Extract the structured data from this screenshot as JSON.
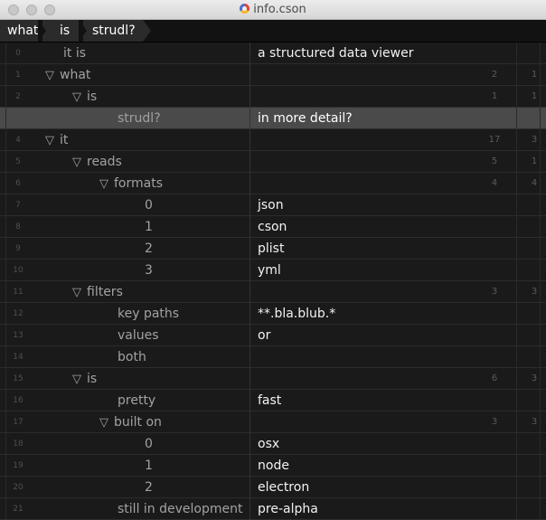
{
  "window": {
    "title": "info.cson",
    "file_icon": "document-color-icon"
  },
  "breadcrumb": [
    "what",
    "is",
    "strudl?"
  ],
  "rows": [
    {
      "num": "0",
      "depth": 0,
      "tri": false,
      "key": "it is",
      "value": "a structured data viewer",
      "c1": "",
      "c2": ""
    },
    {
      "num": "1",
      "depth": 0,
      "tri": true,
      "key": "what",
      "value": "",
      "c1": "2",
      "c2": "1"
    },
    {
      "num": "2",
      "depth": 1,
      "tri": true,
      "key": "is",
      "value": "",
      "c1": "1",
      "c2": "1"
    },
    {
      "num": "",
      "depth": 2,
      "tri": false,
      "key": "strudl?",
      "value": "in more detail?",
      "c1": "",
      "c2": "",
      "selected": true
    },
    {
      "num": "4",
      "depth": 0,
      "tri": true,
      "key": "it",
      "value": "",
      "c1": "17",
      "c2": "3"
    },
    {
      "num": "5",
      "depth": 1,
      "tri": true,
      "key": "reads",
      "value": "",
      "c1": "5",
      "c2": "1"
    },
    {
      "num": "6",
      "depth": 2,
      "tri": true,
      "key": "formats",
      "value": "",
      "c1": "4",
      "c2": "4"
    },
    {
      "num": "7",
      "depth": 3,
      "tri": false,
      "key": "0",
      "value": "json",
      "c1": "",
      "c2": ""
    },
    {
      "num": "8",
      "depth": 3,
      "tri": false,
      "key": "1",
      "value": "cson",
      "c1": "",
      "c2": ""
    },
    {
      "num": "9",
      "depth": 3,
      "tri": false,
      "key": "2",
      "value": "plist",
      "c1": "",
      "c2": ""
    },
    {
      "num": "10",
      "depth": 3,
      "tri": false,
      "key": "3",
      "value": "yml",
      "c1": "",
      "c2": ""
    },
    {
      "num": "11",
      "depth": 1,
      "tri": true,
      "key": "filters",
      "value": "",
      "c1": "3",
      "c2": "3"
    },
    {
      "num": "12",
      "depth": 2,
      "tri": false,
      "key": "key paths",
      "value": "**.bla.blub.*",
      "c1": "",
      "c2": ""
    },
    {
      "num": "13",
      "depth": 2,
      "tri": false,
      "key": "values",
      "value": "or",
      "c1": "",
      "c2": ""
    },
    {
      "num": "14",
      "depth": 2,
      "tri": false,
      "key": "both",
      "value": "",
      "c1": "",
      "c2": ""
    },
    {
      "num": "15",
      "depth": 1,
      "tri": true,
      "key": "is",
      "value": "",
      "c1": "6",
      "c2": "3"
    },
    {
      "num": "16",
      "depth": 2,
      "tri": false,
      "key": "pretty",
      "value": "fast",
      "c1": "",
      "c2": ""
    },
    {
      "num": "17",
      "depth": 2,
      "tri": true,
      "key": "built on",
      "value": "",
      "c1": "3",
      "c2": "3"
    },
    {
      "num": "18",
      "depth": 3,
      "tri": false,
      "key": "0",
      "value": "osx",
      "c1": "",
      "c2": ""
    },
    {
      "num": "19",
      "depth": 3,
      "tri": false,
      "key": "1",
      "value": "node",
      "c1": "",
      "c2": ""
    },
    {
      "num": "20",
      "depth": 3,
      "tri": false,
      "key": "2",
      "value": "electron",
      "c1": "",
      "c2": ""
    },
    {
      "num": "21",
      "depth": 2,
      "tri": false,
      "key": "still in development",
      "value": "pre-alpha",
      "c1": "",
      "c2": ""
    }
  ],
  "icons": {
    "expand": "disclosure-triangle-icon",
    "tri_glyph": "▽"
  }
}
